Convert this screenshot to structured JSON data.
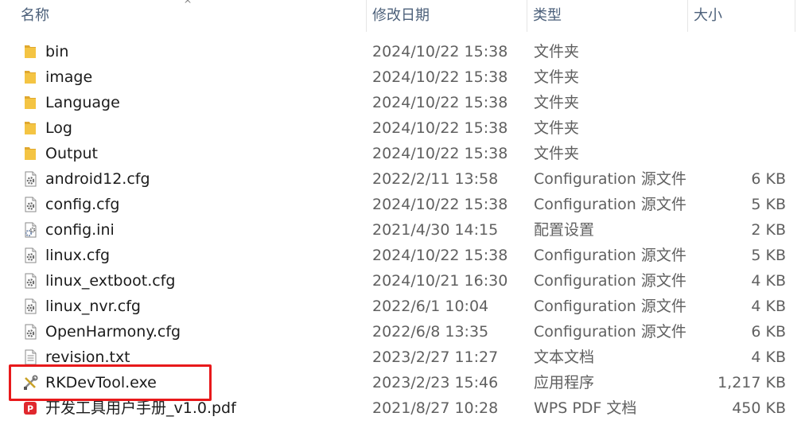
{
  "header": {
    "name_label": "名称",
    "date_label": "修改日期",
    "type_label": "类型",
    "size_label": "大小",
    "sort_indicator": "^"
  },
  "files": [
    {
      "name": "bin",
      "date": "2024/10/22 15:38",
      "type": "文件夹",
      "size": "",
      "icon": "folder-icon"
    },
    {
      "name": "image",
      "date": "2024/10/22 15:38",
      "type": "文件夹",
      "size": "",
      "icon": "folder-icon"
    },
    {
      "name": "Language",
      "date": "2024/10/22 15:38",
      "type": "文件夹",
      "size": "",
      "icon": "folder-icon"
    },
    {
      "name": "Log",
      "date": "2024/10/22 15:38",
      "type": "文件夹",
      "size": "",
      "icon": "folder-icon"
    },
    {
      "name": "Output",
      "date": "2024/10/22 15:38",
      "type": "文件夹",
      "size": "",
      "icon": "folder-icon"
    },
    {
      "name": "android12.cfg",
      "date": "2022/2/11 13:58",
      "type": "Configuration 源文件",
      "size": "6 KB",
      "icon": "config-file-icon"
    },
    {
      "name": "config.cfg",
      "date": "2024/10/22 15:38",
      "type": "Configuration 源文件",
      "size": "5 KB",
      "icon": "config-file-icon"
    },
    {
      "name": "config.ini",
      "date": "2021/4/30 14:15",
      "type": "配置设置",
      "size": "2 KB",
      "icon": "ini-file-icon"
    },
    {
      "name": "linux.cfg",
      "date": "2024/10/22 15:38",
      "type": "Configuration 源文件",
      "size": "5 KB",
      "icon": "config-file-icon"
    },
    {
      "name": "linux_extboot.cfg",
      "date": "2024/10/21 16:30",
      "type": "Configuration 源文件",
      "size": "4 KB",
      "icon": "config-file-icon"
    },
    {
      "name": "linux_nvr.cfg",
      "date": "2022/6/1 10:04",
      "type": "Configuration 源文件",
      "size": "4 KB",
      "icon": "config-file-icon"
    },
    {
      "name": "OpenHarmony.cfg",
      "date": "2022/6/8 13:35",
      "type": "Configuration 源文件",
      "size": "6 KB",
      "icon": "config-file-icon"
    },
    {
      "name": "revision.txt",
      "date": "2023/2/27 11:27",
      "type": "文本文档",
      "size": "4 KB",
      "icon": "text-file-icon"
    },
    {
      "name": "RKDevTool.exe",
      "date": "2023/2/23 15:46",
      "type": "应用程序",
      "size": "1,217 KB",
      "icon": "tools-app-icon"
    },
    {
      "name": "开发工具用户手册_v1.0.pdf",
      "date": "2021/8/27 10:28",
      "type": "WPS PDF 文档",
      "size": "450 KB",
      "icon": "pdf-file-icon"
    }
  ],
  "colors": {
    "folder": "#f4c443",
    "highlight_box": "#e8191b",
    "header_text": "#4c607a",
    "pdf": "#e0282e"
  },
  "highlighted_file": "RKDevTool.exe"
}
